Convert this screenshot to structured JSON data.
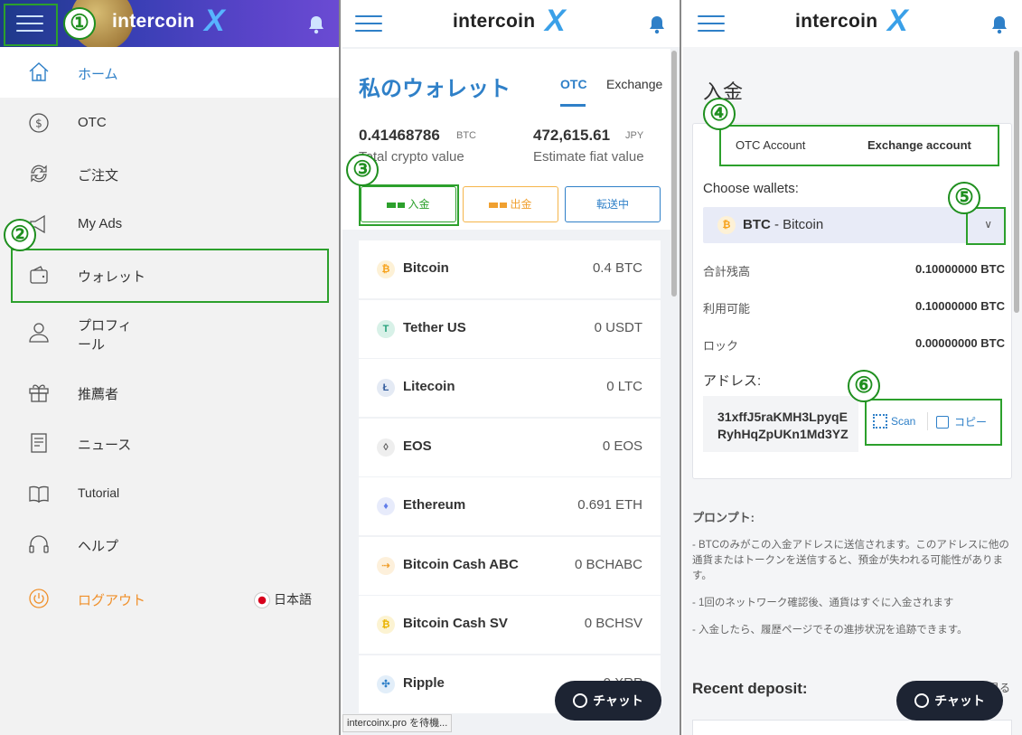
{
  "brand": {
    "logo_text": "intercoin",
    "logo_mark": "X",
    "accent": "#2f80c8",
    "annotation_color": "#2ca02c"
  },
  "menu": {
    "items": [
      {
        "label": "ホーム",
        "icon": "home-icon"
      },
      {
        "label": "OTC",
        "icon": "dollar-circle-icon"
      },
      {
        "label": "ご注文",
        "icon": "exchange-icon"
      },
      {
        "label": "My Ads",
        "icon": "megaphone-icon"
      },
      {
        "label": "ウォレット",
        "icon": "wallet-icon"
      },
      {
        "label": "プロフィール",
        "icon": "user-icon"
      },
      {
        "label": "推薦者",
        "icon": "gift-icon"
      },
      {
        "label": "ニュース",
        "icon": "news-icon"
      },
      {
        "label": "Tutorial",
        "icon": "book-icon"
      },
      {
        "label": "ヘルプ",
        "icon": "headset-icon"
      }
    ],
    "logout": "ログアウト",
    "language": "日本語"
  },
  "annotations": [
    "①",
    "②",
    "③",
    "④",
    "⑤",
    "⑥"
  ],
  "wallet": {
    "title": "私のウォレット",
    "tabs": [
      "OTC",
      "Exchange"
    ],
    "total_crypto": "0.41468786",
    "total_crypto_unit": "BTC",
    "total_crypto_label": "Total crypto value",
    "fiat": "472,615.61",
    "fiat_unit": "JPY",
    "fiat_label": "Estimate fiat value",
    "buttons": {
      "deposit": "入金",
      "withdraw": "出金",
      "transfer": "転送中"
    },
    "coins": [
      {
        "name": "Bitcoin",
        "balance": "0.4 BTC",
        "symbol": "₿",
        "color": "#f7a21b"
      },
      {
        "name": "Tether US",
        "balance": "0 USDT",
        "symbol": "T",
        "color": "#26a17b"
      },
      {
        "name": "Litecoin",
        "balance": "0 LTC",
        "symbol": "Ł",
        "color": "#345d9d"
      },
      {
        "name": "EOS",
        "balance": "0 EOS",
        "symbol": "◊",
        "color": "#555555"
      },
      {
        "name": "Ethereum",
        "balance": "0.691 ETH",
        "symbol": "♦",
        "color": "#627eea"
      },
      {
        "name": "Bitcoin Cash ABC",
        "balance": "0 BCHABC",
        "symbol": "⇢",
        "color": "#f0a030"
      },
      {
        "name": "Bitcoin Cash SV",
        "balance": "0 BCHSV",
        "symbol": "₿",
        "color": "#eab300"
      },
      {
        "name": "Ripple",
        "balance": "0 XRP",
        "symbol": "✣",
        "color": "#2f80c8"
      }
    ],
    "status_bar": "intercoinx.pro を待機..."
  },
  "chat_label": "チャット",
  "deposit": {
    "title": "入金",
    "account_tabs": [
      "OTC Account",
      "Exchange account"
    ],
    "choose_label": "Choose wallets:",
    "selected_symbol": "BTC",
    "selected_name": " - Bitcoin",
    "rows": [
      {
        "label": "合計残高",
        "value": "0.10000000 BTC"
      },
      {
        "label": "利用可能",
        "value": "0.10000000 BTC"
      },
      {
        "label": "ロック",
        "value": "0.00000000 BTC"
      }
    ],
    "address_label": "アドレス:",
    "address": "31xffJ5raKMH3LpyqERyhHqZpUKn1Md3YZ",
    "scan_label": "Scan",
    "copy_label": "コピー",
    "prompt_title": "プロンプト:",
    "prompts": [
      "- BTCのみがこの入金アドレスに送信されます。このアドレスに他の通貨またはトークンを送信すると、預金が失われる可能性があります。",
      "- 1回のネットワーク確認後、通貨はすぐに入金されます",
      "- 入金したら、履歴ページでその進捗状況を追跡できます。"
    ],
    "recent_title": "Recent deposit:",
    "recent_more": "もっと見る"
  }
}
